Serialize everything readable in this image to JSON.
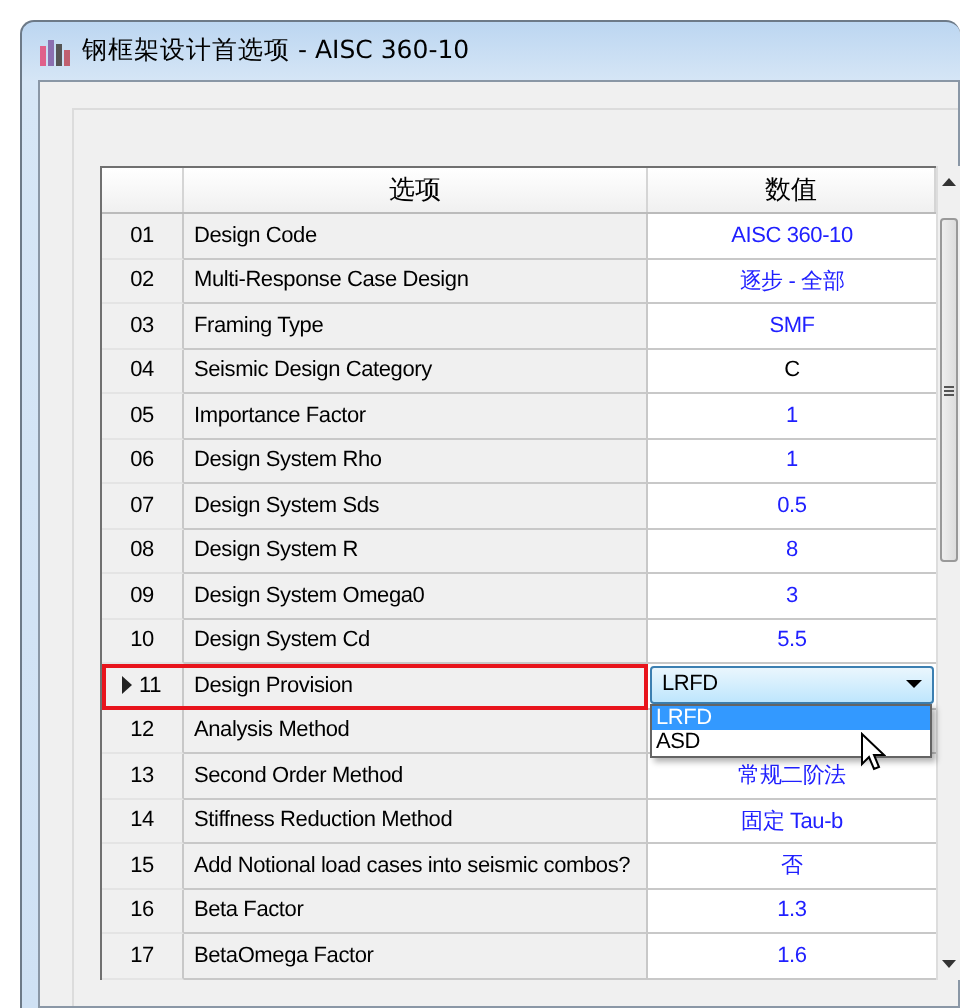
{
  "window": {
    "title": "钢框架设计首选项 - AISC 360-10"
  },
  "grid": {
    "columns": [
      "选项",
      "数值"
    ],
    "rows": [
      {
        "number": "01",
        "option": "Design Code",
        "kind": "text",
        "value": "AISC 360-10",
        "color": "#2020ff",
        "selected": false
      },
      {
        "number": "02",
        "option": "Multi-Response Case Design",
        "kind": "text",
        "value": "逐步 - 全部",
        "color": "#2020ff",
        "selected": false
      },
      {
        "number": "03",
        "option": "Framing Type",
        "kind": "text",
        "value": "SMF",
        "color": "#2020ff",
        "selected": false
      },
      {
        "number": "04",
        "option": "Seismic Design Category",
        "kind": "text",
        "value": "C",
        "color": "#000000",
        "selected": false
      },
      {
        "number": "05",
        "option": "Importance Factor",
        "kind": "text",
        "value": "1",
        "color": "#2020ff",
        "selected": false
      },
      {
        "number": "06",
        "option": "Design System Rho",
        "kind": "text",
        "value": "1",
        "color": "#2020ff",
        "selected": false
      },
      {
        "number": "07",
        "option": "Design System Sds",
        "kind": "text",
        "value": "0.5",
        "color": "#2020ff",
        "selected": false
      },
      {
        "number": "08",
        "option": "Design System R",
        "kind": "text",
        "value": "8",
        "color": "#2020ff",
        "selected": false
      },
      {
        "number": "09",
        "option": "Design System Omega0",
        "kind": "text",
        "value": "3",
        "color": "#2020ff",
        "selected": false
      },
      {
        "number": "10",
        "option": "Design System Cd",
        "kind": "text",
        "value": "5.5",
        "color": "#2020ff",
        "selected": false
      },
      {
        "number": "11",
        "option": "Design Provision",
        "kind": "dropdown",
        "value": "LRFD",
        "selected": true,
        "options": [
          {
            "label": "LRFD",
            "selected": true
          },
          {
            "label": "ASD",
            "selected": false
          }
        ]
      },
      {
        "number": "12",
        "option": "Analysis Method",
        "kind": "hidden",
        "selected": false
      },
      {
        "number": "13",
        "option": "Second Order Method",
        "kind": "text",
        "value": "常规二阶法",
        "color": "#2020ff",
        "selected": false
      },
      {
        "number": "14",
        "option": "Stiffness Reduction Method",
        "kind": "text",
        "value": "固定 Tau-b",
        "color": "#2020ff",
        "selected": false
      },
      {
        "number": "15",
        "option": "Add Notional load cases into seismic combos?",
        "kind": "text",
        "value": "否",
        "color": "#2020ff",
        "selected": false
      },
      {
        "number": "16",
        "option": "Beta Factor",
        "kind": "text",
        "value": "1.3",
        "color": "#2020ff",
        "selected": false
      },
      {
        "number": "17",
        "option": "BetaOmega Factor",
        "kind": "text",
        "value": "1.6",
        "color": "#2020ff",
        "selected": false
      }
    ]
  }
}
